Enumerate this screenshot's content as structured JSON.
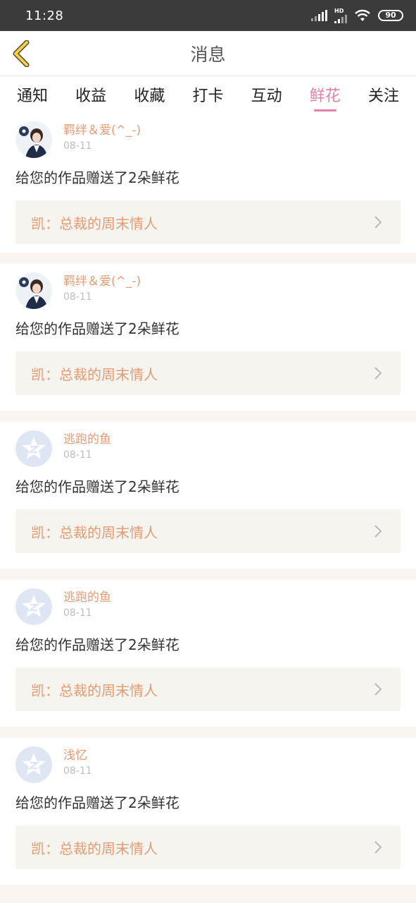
{
  "status": {
    "time": "11:28",
    "hd": "HD",
    "battery": "90"
  },
  "header": {
    "title": "消息"
  },
  "tabs": [
    {
      "label": "通知",
      "active": false
    },
    {
      "label": "收益",
      "active": false
    },
    {
      "label": "收藏",
      "active": false
    },
    {
      "label": "打卡",
      "active": false
    },
    {
      "label": "互动",
      "active": false
    },
    {
      "label": "鲜花",
      "active": true
    },
    {
      "label": "关注",
      "active": false
    }
  ],
  "messages": [
    {
      "username": "羁绊＆爱(^_-)",
      "date": "08-11",
      "avatar": "photo-avatar",
      "text": "给您的作品赠送了2朵鲜花",
      "work": "凯：总裁的周末情人"
    },
    {
      "username": "羁绊＆爱(^_-)",
      "date": "08-11",
      "avatar": "photo-avatar",
      "text": "给您的作品赠送了2朵鲜花",
      "work": "凯：总裁的周末情人"
    },
    {
      "username": "逃跑的鱼",
      "date": "08-11",
      "avatar": "default-avatar",
      "text": "给您的作品赠送了2朵鲜花",
      "work": "凯：总裁的周末情人"
    },
    {
      "username": "逃跑的鱼",
      "date": "08-11",
      "avatar": "default-avatar",
      "text": "给您的作品赠送了2朵鲜花",
      "work": "凯：总裁的周末情人"
    },
    {
      "username": "浅忆",
      "date": "08-11",
      "avatar": "default-avatar",
      "text": "给您的作品赠送了2朵鲜花",
      "work": "凯：总裁的周末情人"
    }
  ],
  "colors": {
    "accent": "#e57fa6",
    "username": "#e79b74",
    "work_bg": "#f5f4ee",
    "back_icon": "#f2d24a"
  }
}
